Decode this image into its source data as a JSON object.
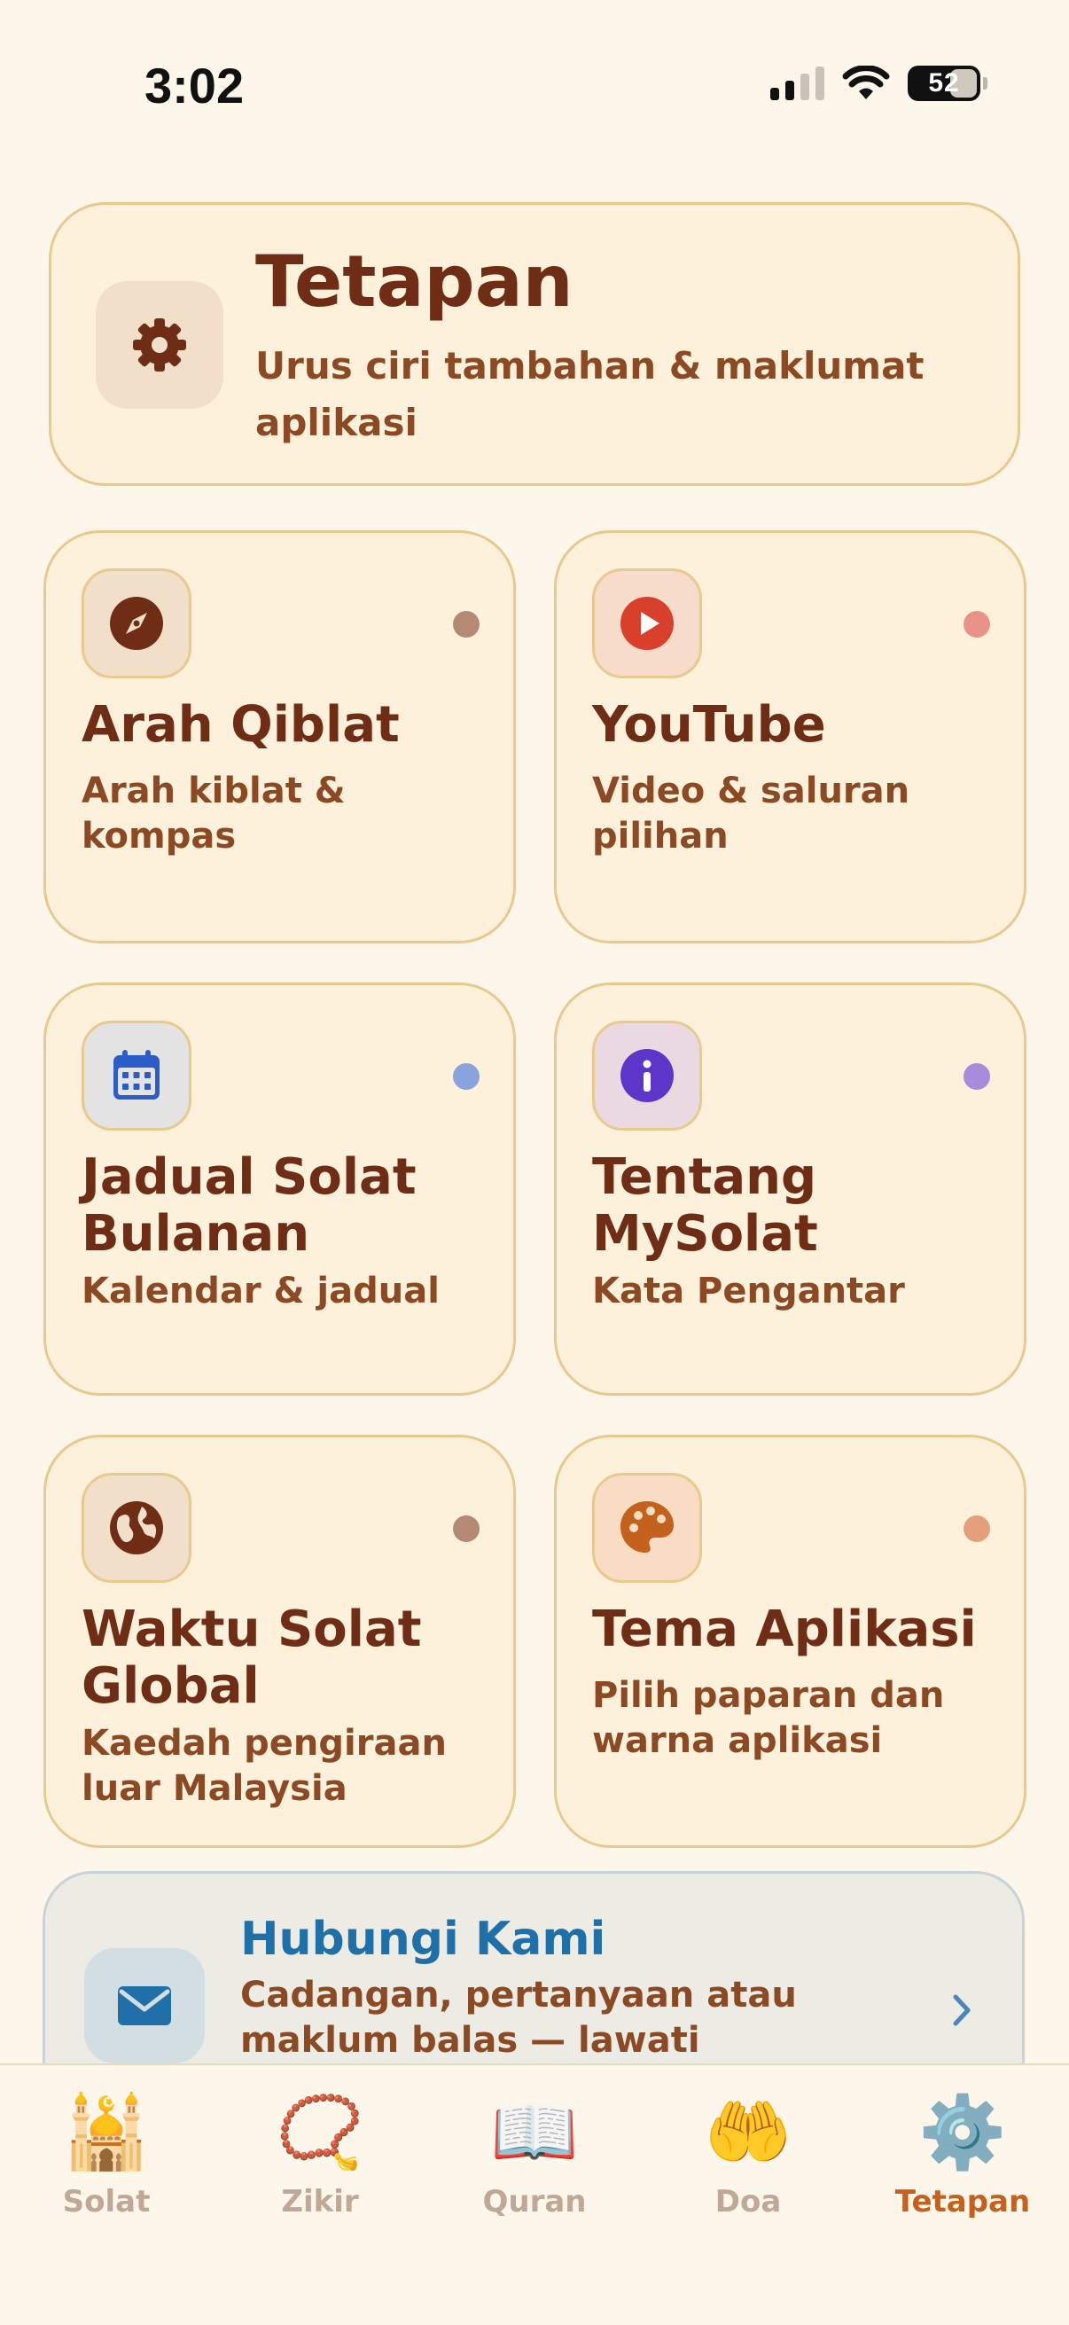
{
  "status_bar": {
    "time": "3:02",
    "battery": "52"
  },
  "header": {
    "title": "Tetapan",
    "subtitle": "Urus ciri tambahan & maklumat aplikasi",
    "icon": "gear-icon"
  },
  "cards": [
    {
      "title": "Arah Qiblat",
      "subtitle": "Arah kiblat & kompas",
      "icon": "compass-icon",
      "icon_color": "#6E2D14",
      "icon_bg": "#F1DFCA",
      "dot_color": "#B48A76"
    },
    {
      "title": "YouTube",
      "subtitle": "Video & saluran pilihan",
      "icon": "play-icon",
      "icon_color": "#D9402C",
      "icon_bg": "#F8DCCB",
      "dot_color": "#E9928A"
    },
    {
      "title": "Jadual Solat Bulanan",
      "subtitle": "Kalendar & jadual",
      "icon": "calendar-icon",
      "icon_color": "#2C5CC7",
      "icon_bg": "#E4E3E4",
      "dot_color": "#8AA3DC"
    },
    {
      "title": "Tentang MySolat",
      "subtitle": "Kata Pengantar",
      "icon": "info-icon",
      "icon_color": "#5B36C9",
      "icon_bg": "#EAD9E0",
      "dot_color": "#A78CDB"
    },
    {
      "title": "Waktu Solat Global",
      "subtitle": "Kaedah pengiraan luar Malaysia",
      "icon": "globe-icon",
      "icon_color": "#6E2D14",
      "icon_bg": "#F1DFCA",
      "dot_color": "#B48A76"
    },
    {
      "title": "Tema Aplikasi",
      "subtitle": "Pilih paparan dan warna aplikasi",
      "icon": "palette-icon",
      "icon_color": "#C4611D",
      "icon_bg": "#F8DCC3",
      "dot_color": "#E3A07A"
    }
  ],
  "contact": {
    "title": "Hubungi Kami",
    "subtitle": "Cadangan, pertanyaan atau maklum balas — lawati",
    "icon": "mail-icon"
  },
  "tabs": [
    {
      "label": "Solat",
      "emoji": "🕌",
      "icon": "mosque-icon"
    },
    {
      "label": "Zikir",
      "emoji": "📿",
      "icon": "prayer-beads-icon"
    },
    {
      "label": "Quran",
      "emoji": "📖",
      "icon": "open-book-icon"
    },
    {
      "label": "Doa",
      "emoji": "🤲",
      "icon": "palms-up-icon"
    },
    {
      "label": "Tetapan",
      "emoji": "⚙️",
      "icon": "gear-icon",
      "active": true
    }
  ],
  "colors": {
    "background": "#FDF6EA",
    "card_border": "#E8C98E",
    "card_bg": "#FEF1DC",
    "title": "#6E2D14",
    "subtitle": "#8B4A23",
    "accent": "#C4611D",
    "contact_title": "#1F6FA8"
  }
}
